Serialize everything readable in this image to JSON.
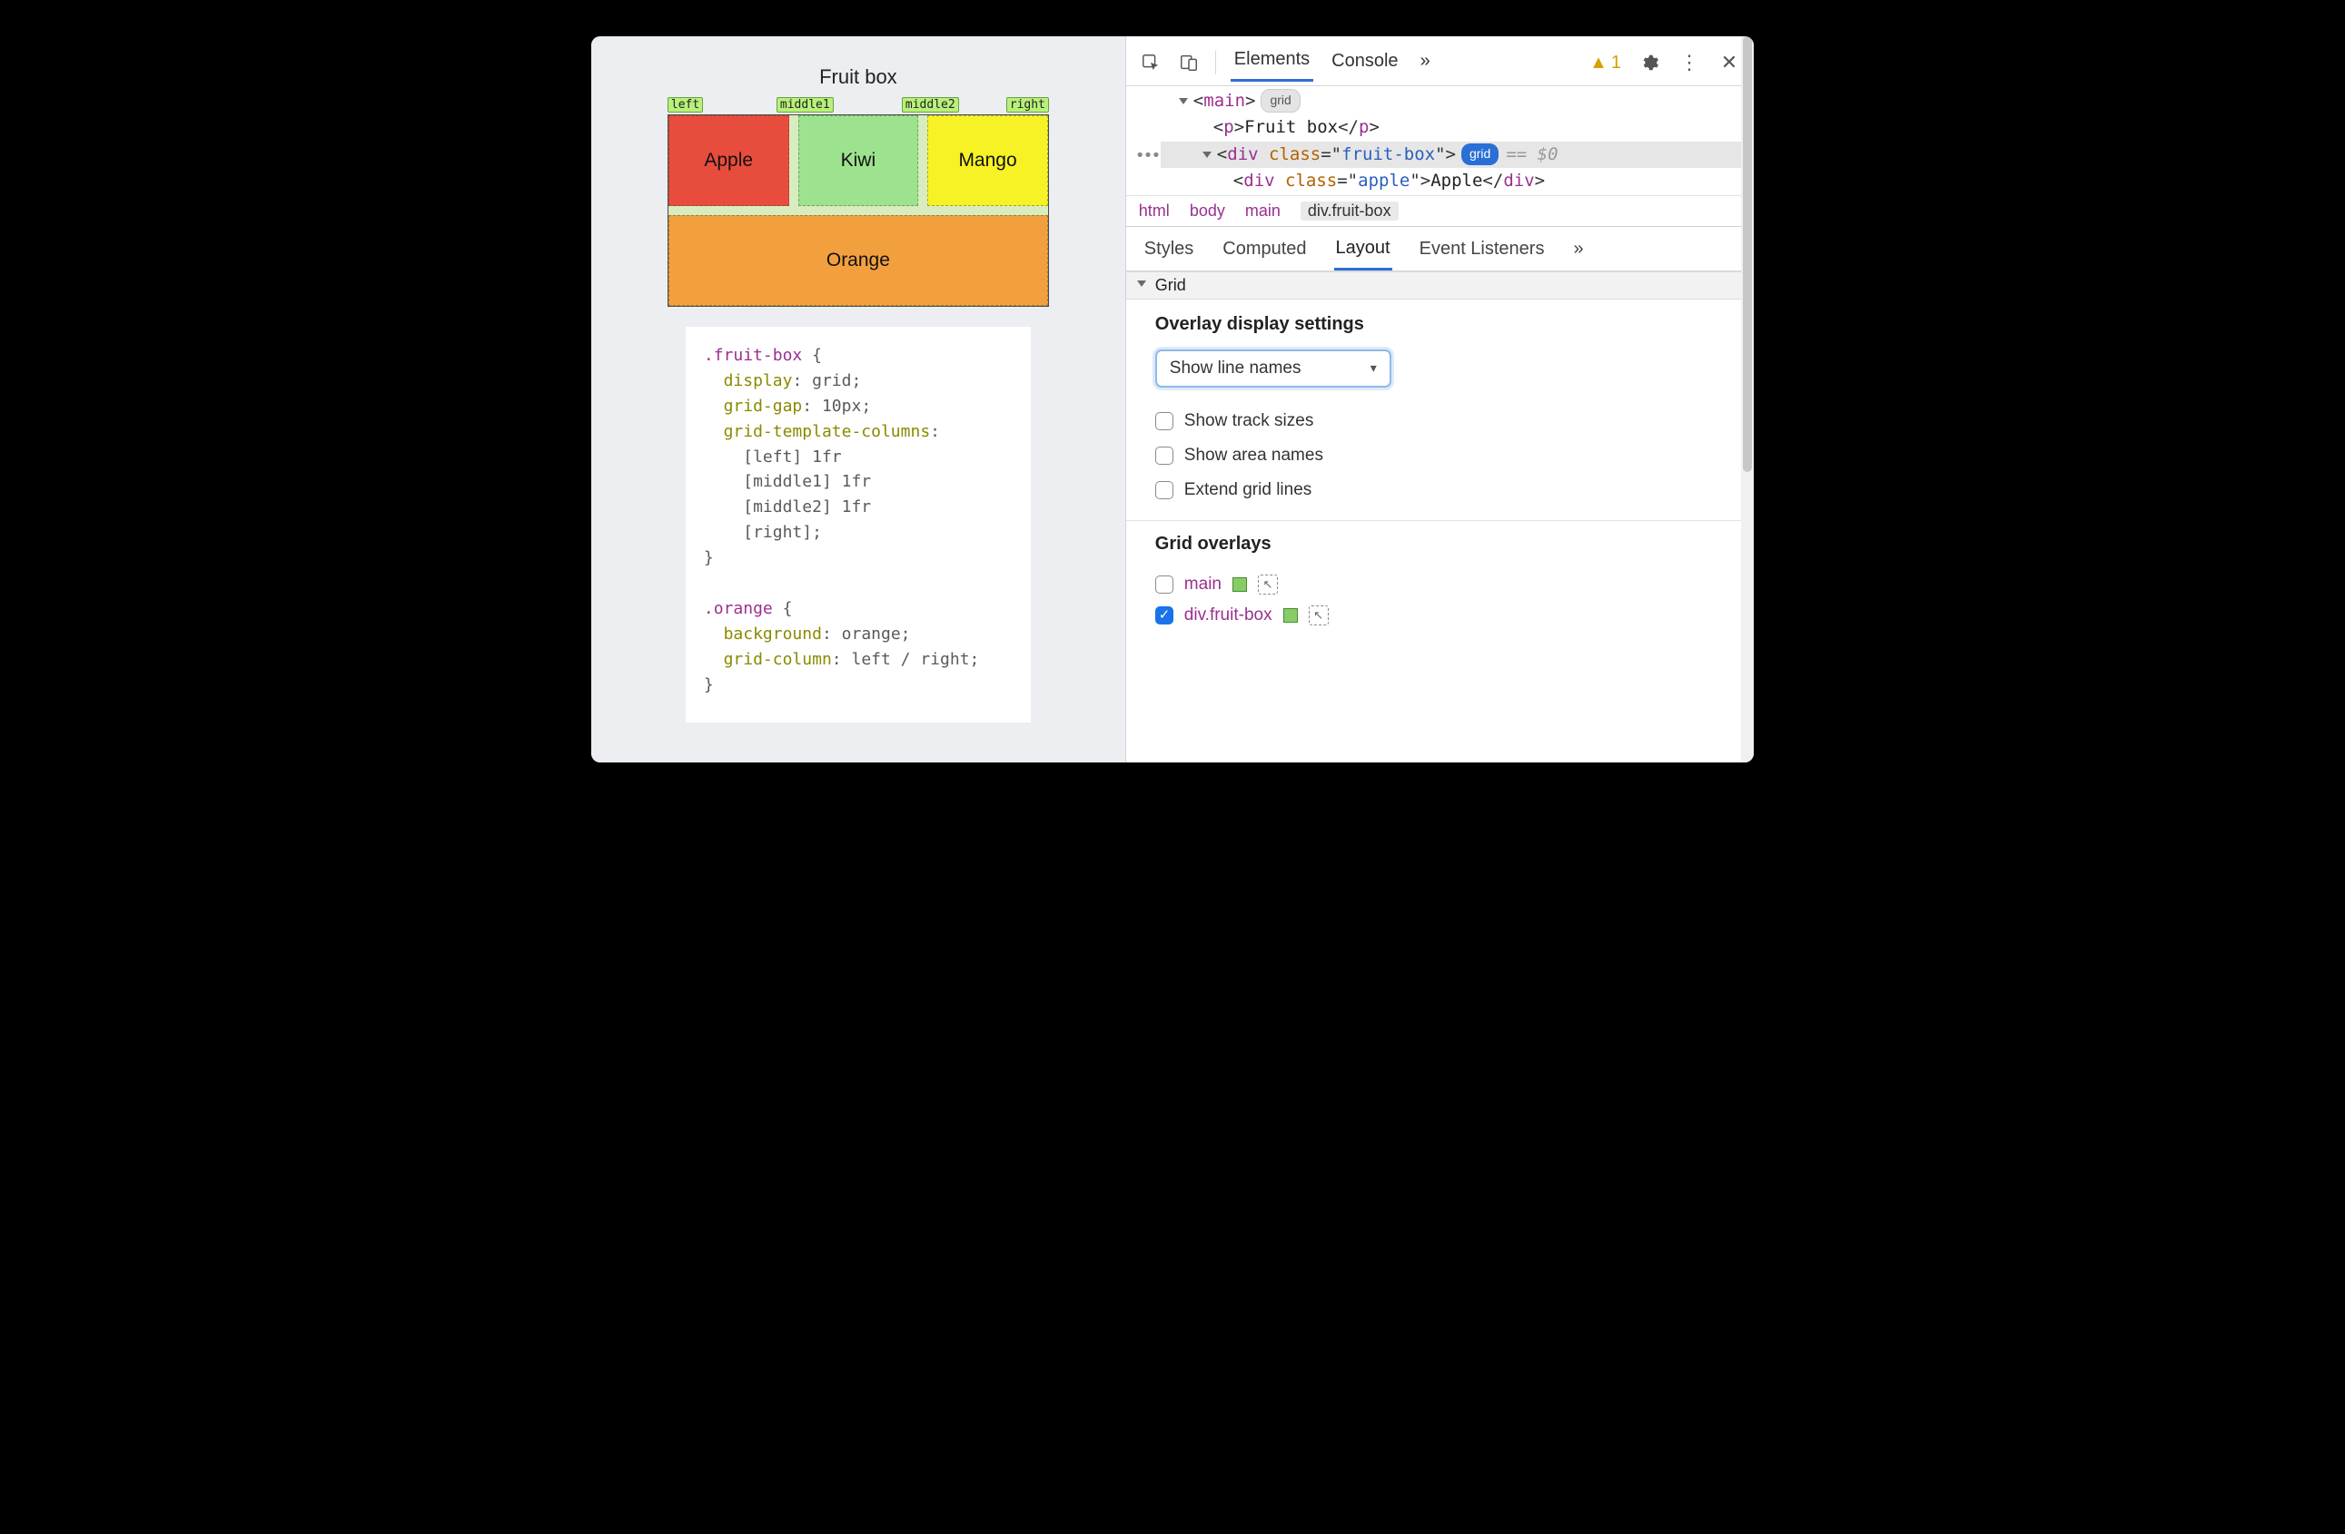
{
  "preview": {
    "title": "Fruit box",
    "line_names": [
      "left",
      "middle1",
      "middle2",
      "right"
    ],
    "cells": {
      "apple": "Apple",
      "kiwi": "Kiwi",
      "mango": "Mango",
      "orange": "Orange"
    },
    "css": {
      "sel1": ".fruit-box",
      "props1": [
        {
          "name": "display",
          "value": "grid;"
        },
        {
          "name": "grid-gap",
          "value": "10px;"
        },
        {
          "name": "grid-template-columns",
          "value": ""
        }
      ],
      "cols": [
        "  [left] 1fr",
        "  [middle1] 1fr",
        "  [middle2] 1fr",
        "  [right];"
      ],
      "sel2": ".orange",
      "props2": [
        {
          "name": "background",
          "value": "orange;"
        },
        {
          "name": "grid-column",
          "value": "left / right;"
        }
      ]
    }
  },
  "devtools": {
    "tabs": {
      "elements": "Elements",
      "console": "Console",
      "more": "»"
    },
    "warning_count": "1",
    "dom": {
      "main_tag": "main",
      "main_badge": "grid",
      "p_tag": "p",
      "p_text": "Fruit box",
      "div_tag": "div",
      "class_attr": "class",
      "fruitbox_val": "fruit-box",
      "fruitbox_badge": "grid",
      "eq0": "== $0",
      "apple_val": "apple",
      "apple_text": "Apple"
    },
    "breadcrumb": [
      "html",
      "body",
      "main",
      "div.fruit-box"
    ],
    "subtabs": {
      "styles": "Styles",
      "computed": "Computed",
      "layout": "Layout",
      "listeners": "Event Listeners",
      "more": "»"
    },
    "section_title": "Grid",
    "overlay_settings": {
      "heading": "Overlay display settings",
      "dropdown": "Show line names",
      "opts": [
        "Show track sizes",
        "Show area names",
        "Extend grid lines"
      ]
    },
    "grid_overlays": {
      "heading": "Grid overlays",
      "items": [
        {
          "name": "main",
          "checked": false
        },
        {
          "name": "div.fruit-box",
          "checked": true
        }
      ]
    }
  }
}
